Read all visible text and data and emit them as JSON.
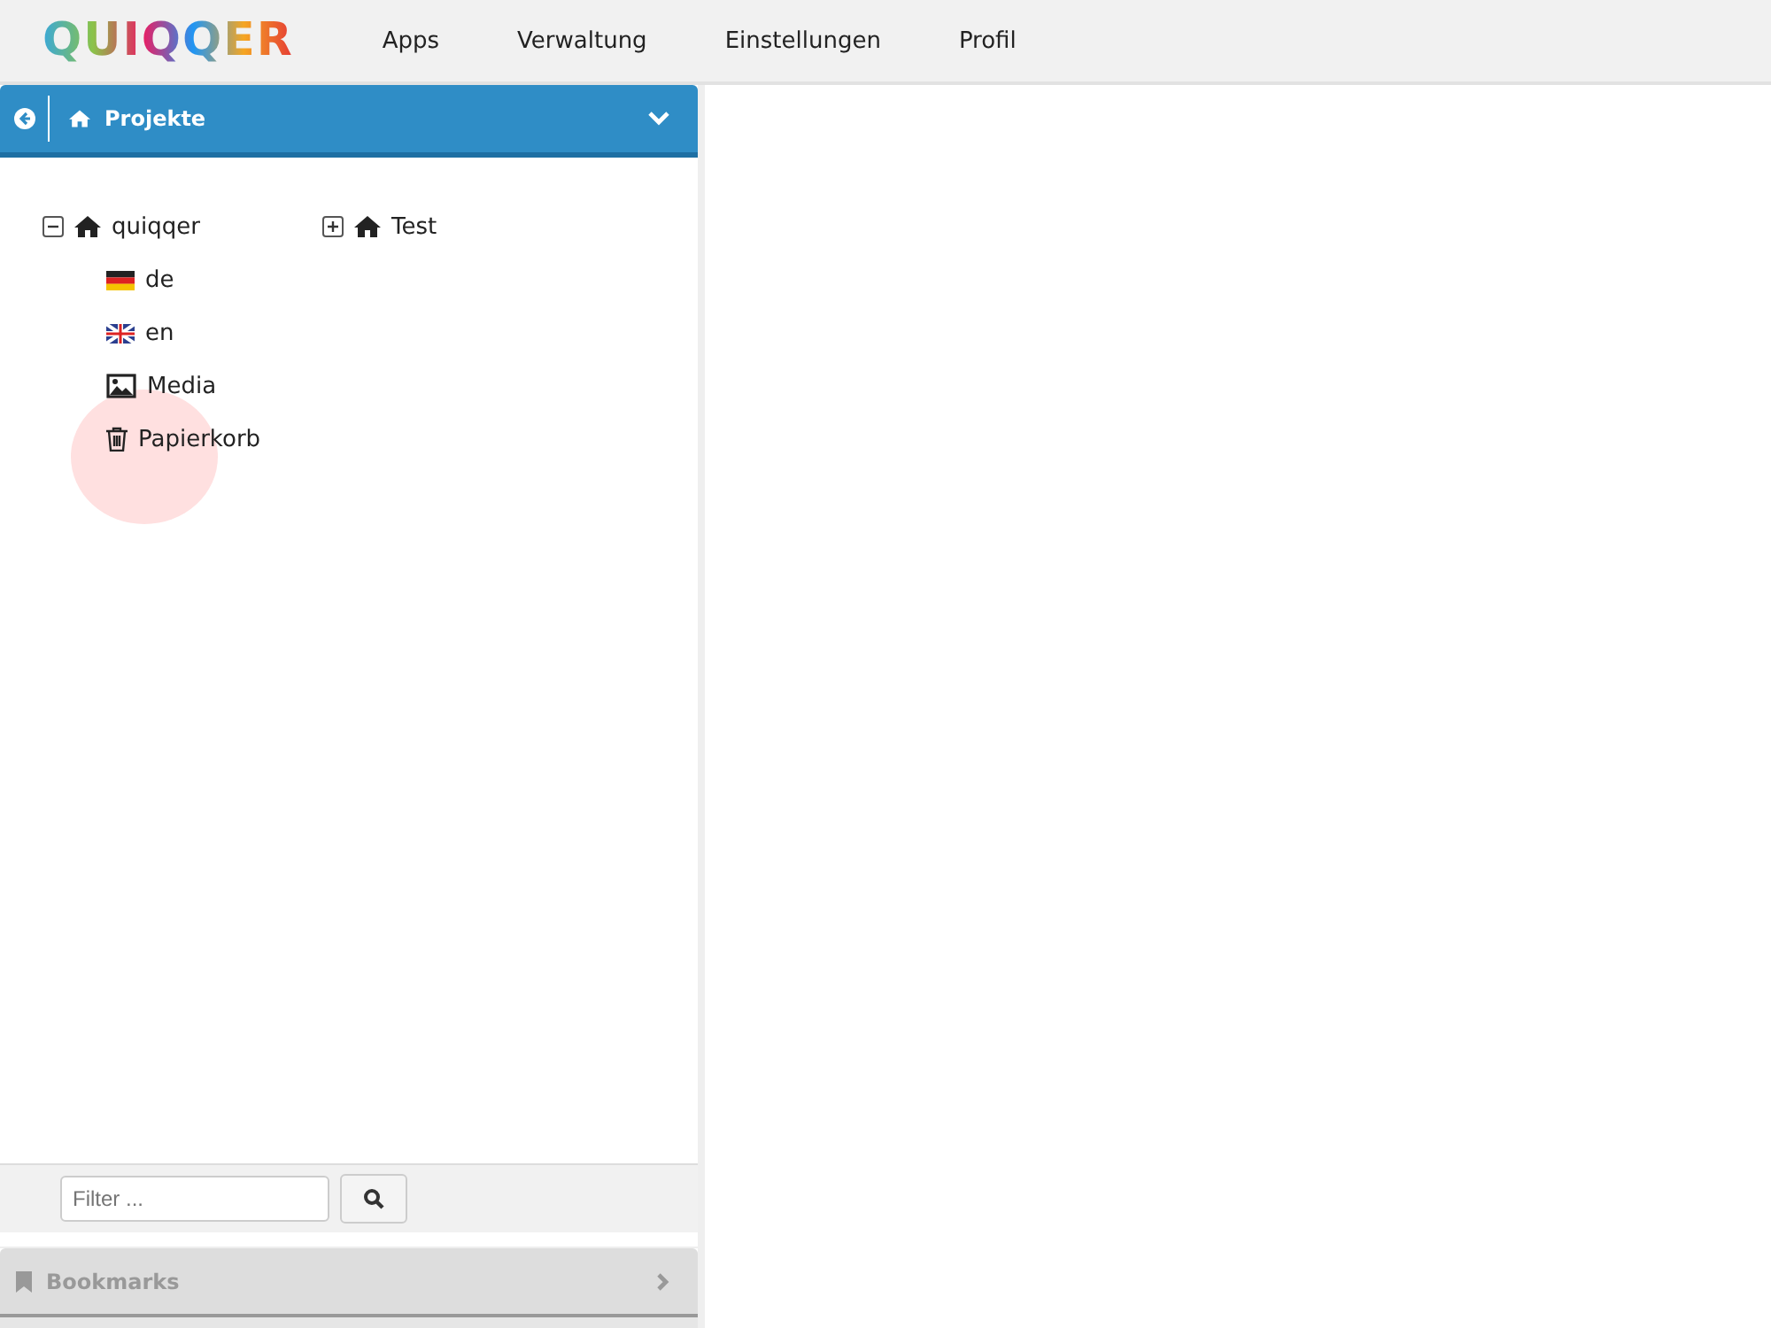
{
  "logo": "QUIQQER",
  "menu": [
    {
      "label": "Apps"
    },
    {
      "label": "Verwaltung"
    },
    {
      "label": "Einstellungen"
    },
    {
      "label": "Profil"
    }
  ],
  "panel": {
    "title": "Projekte",
    "expanded": true
  },
  "projects": [
    {
      "label": "quiqqer",
      "kind": "home",
      "expanded": true,
      "children": [
        {
          "label": "de",
          "kind": "flag-de"
        },
        {
          "label": "en",
          "kind": "flag-en"
        },
        {
          "label": "Media",
          "kind": "media"
        },
        {
          "label": "Papierkorb",
          "kind": "trash"
        }
      ]
    },
    {
      "label": "Test",
      "kind": "home",
      "expanded": false
    }
  ],
  "filter": {
    "placeholder": "Filter ..."
  },
  "bookmarks": {
    "title": "Bookmarks",
    "expanded": false
  }
}
